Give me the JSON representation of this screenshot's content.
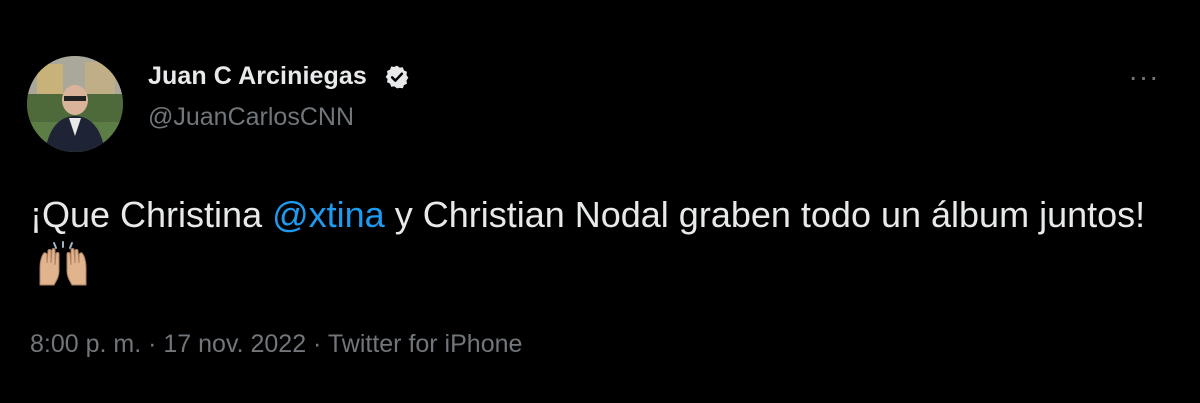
{
  "author": {
    "name": "Juan C Arciniegas",
    "handle": "@JuanCarlosCNN",
    "verified": true
  },
  "more_menu": {
    "label": "···"
  },
  "tweet": {
    "text_part1": "¡Que Christina ",
    "mention": "@xtina",
    "text_part2": " y Christian Nodal graben todo un álbum juntos!",
    "emoji": "raising-hands-icon"
  },
  "meta": {
    "time": "8:00 p. m.",
    "separator1": " · ",
    "date": "17 nov. 2022",
    "separator2": " · ",
    "source": "Twitter for iPhone"
  },
  "colors": {
    "background": "#000000",
    "text": "#e7e9ea",
    "secondary": "#71767b",
    "link": "#1d9bf0"
  }
}
